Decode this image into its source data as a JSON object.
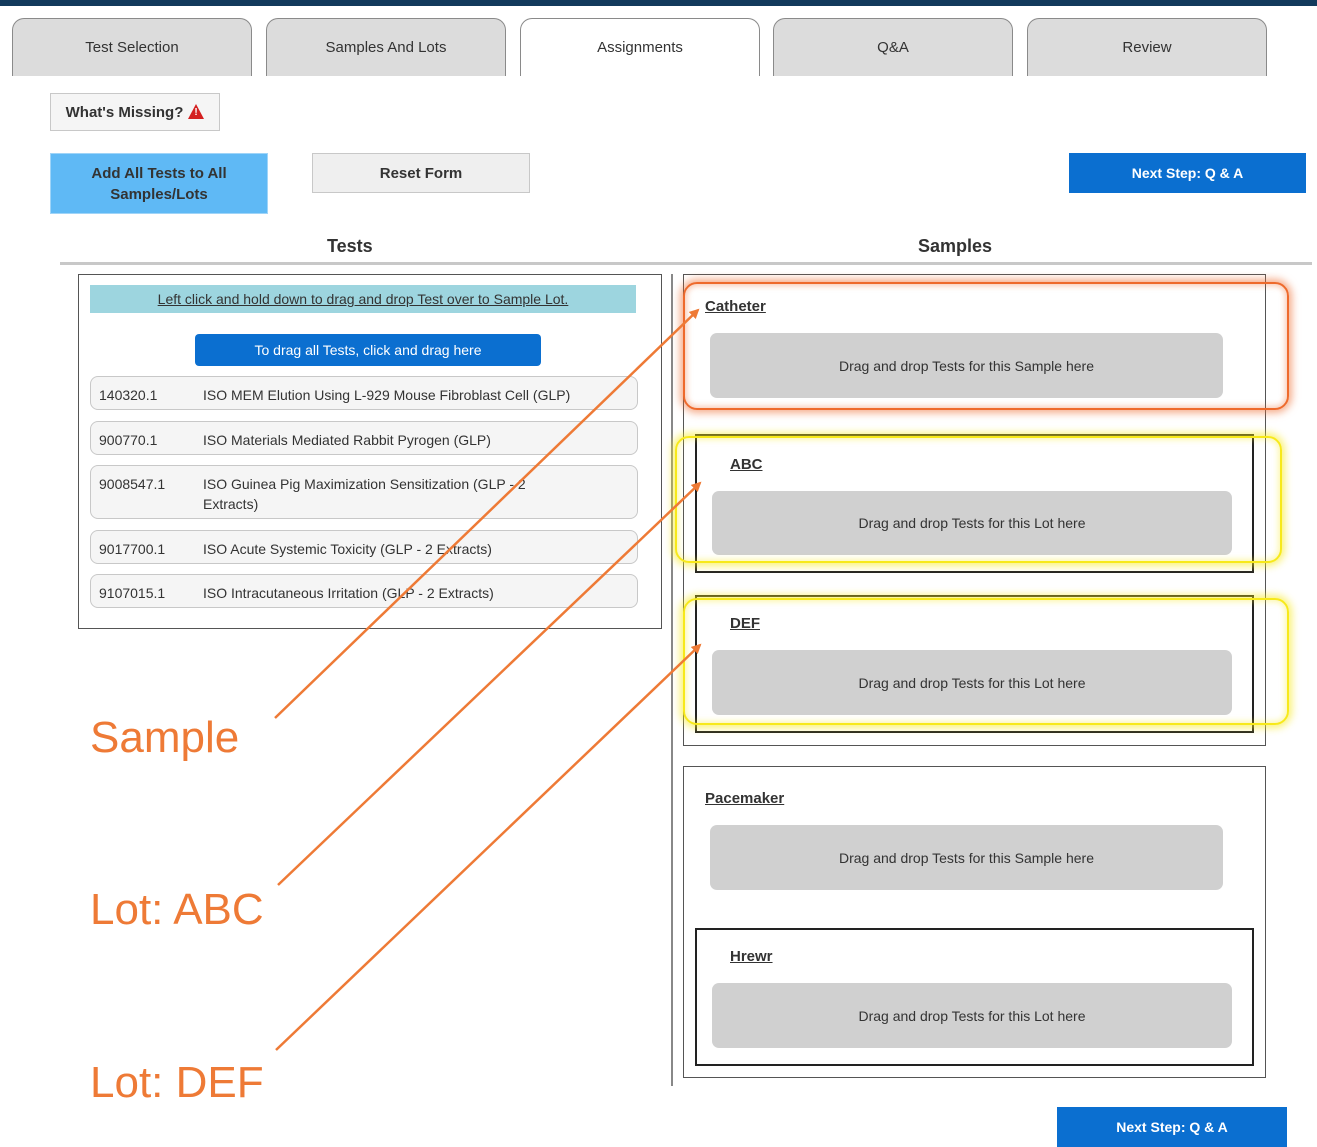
{
  "tabs": [
    {
      "label": "Test Selection"
    },
    {
      "label": "Samples And Lots"
    },
    {
      "label": "Assignments"
    },
    {
      "label": "Q&A"
    },
    {
      "label": "Review"
    }
  ],
  "actions": {
    "whats_missing": "What's Missing?",
    "add_all": "Add All Tests to All Samples/Lots",
    "reset": "Reset Form",
    "next_step": "Next Step: Q & A"
  },
  "columns": {
    "tests": "Tests",
    "samples": "Samples"
  },
  "tests_panel": {
    "instruction": "Left click and hold down to drag and drop Test over to Sample Lot.",
    "drag_all": "To drag all Tests, click and drag here",
    "tests": [
      {
        "code": "140320.1",
        "name": "ISO MEM Elution Using L-929 Mouse Fibroblast Cell (GLP)"
      },
      {
        "code": "900770.1",
        "name": "ISO Materials Mediated Rabbit Pyrogen (GLP)"
      },
      {
        "code": "9008547.1",
        "name": "ISO Guinea Pig Maximization Sensitization (GLP - 2 Extracts)"
      },
      {
        "code": "9017700.1",
        "name": "ISO Acute Systemic Toxicity (GLP - 2 Extracts)"
      },
      {
        "code": "9107015.1",
        "name": "ISO Intracutaneous Irritation (GLP - 2 Extracts)"
      }
    ]
  },
  "samples": [
    {
      "name": "Catheter",
      "drop_text": "Drag and drop Tests for this Sample here",
      "lots": [
        {
          "name": "ABC",
          "drop_text": "Drag and drop Tests for this Lot here"
        },
        {
          "name": "DEF",
          "drop_text": "Drag and drop Tests for this Lot here"
        }
      ]
    },
    {
      "name": "Pacemaker",
      "drop_text": "Drag and drop Tests for this Sample here",
      "lots": [
        {
          "name": "Hrewr",
          "drop_text": "Drag and drop Tests for this Lot here"
        }
      ]
    }
  ],
  "annotations": {
    "sample": "Sample",
    "lot_abc": "Lot: ABC",
    "lot_def": "Lot: DEF",
    "color": "#ee7a36"
  },
  "colors": {
    "primary": "#0b6fd0",
    "add_all": "#5fb9f5",
    "instruction_bg": "#9dd5df",
    "highlight_orange": "#ee6a2c",
    "highlight_yellow": "#f7e91a",
    "warning": "#d42020"
  }
}
